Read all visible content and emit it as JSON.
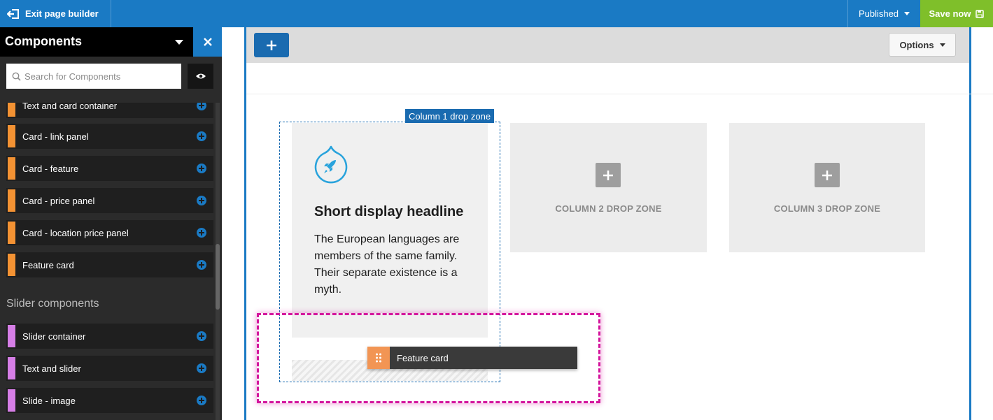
{
  "topbar": {
    "exit_label": "Exit page builder",
    "status_label": "Published",
    "save_label": "Save now",
    "color": "#1a7ac4",
    "save_color": "#7fbf2a"
  },
  "sidebar": {
    "title": "Components",
    "search_placeholder": "Search for Components",
    "card_items": [
      {
        "label": "Text and card container",
        "color": "#f39233"
      },
      {
        "label": "Card - link panel",
        "color": "#f39233"
      },
      {
        "label": "Card - feature",
        "color": "#f39233"
      },
      {
        "label": "Card - price panel",
        "color": "#f39233"
      },
      {
        "label": "Card - location price panel",
        "color": "#f39233"
      },
      {
        "label": "Feature card",
        "color": "#f39233"
      }
    ],
    "slider_heading": "Slider components",
    "slider_items": [
      {
        "label": "Slider container",
        "color": "#d67ee6"
      },
      {
        "label": "Text and slider",
        "color": "#d67ee6"
      },
      {
        "label": "Slide - image",
        "color": "#d67ee6"
      }
    ]
  },
  "canvas": {
    "options_label": "Options",
    "column1_tag": "Column 1 drop zone",
    "feature_card": {
      "icon": "rocket-icon",
      "headline": "Short display headline",
      "body": "The European languages are members of the same family. Their separate existence is a myth."
    },
    "column2_label": "COLUMN 2 DROP ZONE",
    "column3_label": "COLUMN 3 DROP ZONE",
    "dragging_label": "Feature card",
    "highlight_color": "#d4169d"
  }
}
